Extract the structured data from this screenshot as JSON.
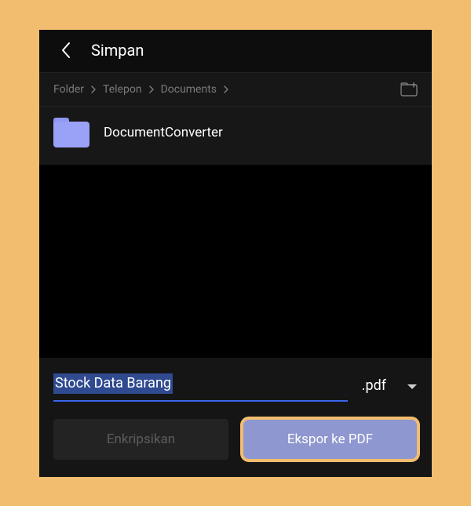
{
  "header": {
    "title": "Simpan"
  },
  "breadcrumb": {
    "items": [
      "Folder",
      "Telepon",
      "Documents"
    ]
  },
  "folders": [
    {
      "name": "DocumentConverter"
    }
  ],
  "filename": {
    "value": "Stock Data Barang",
    "extension": ".pdf"
  },
  "actions": {
    "encrypt_label": "Enkripsikan",
    "export_label": "Ekspor ke PDF"
  }
}
